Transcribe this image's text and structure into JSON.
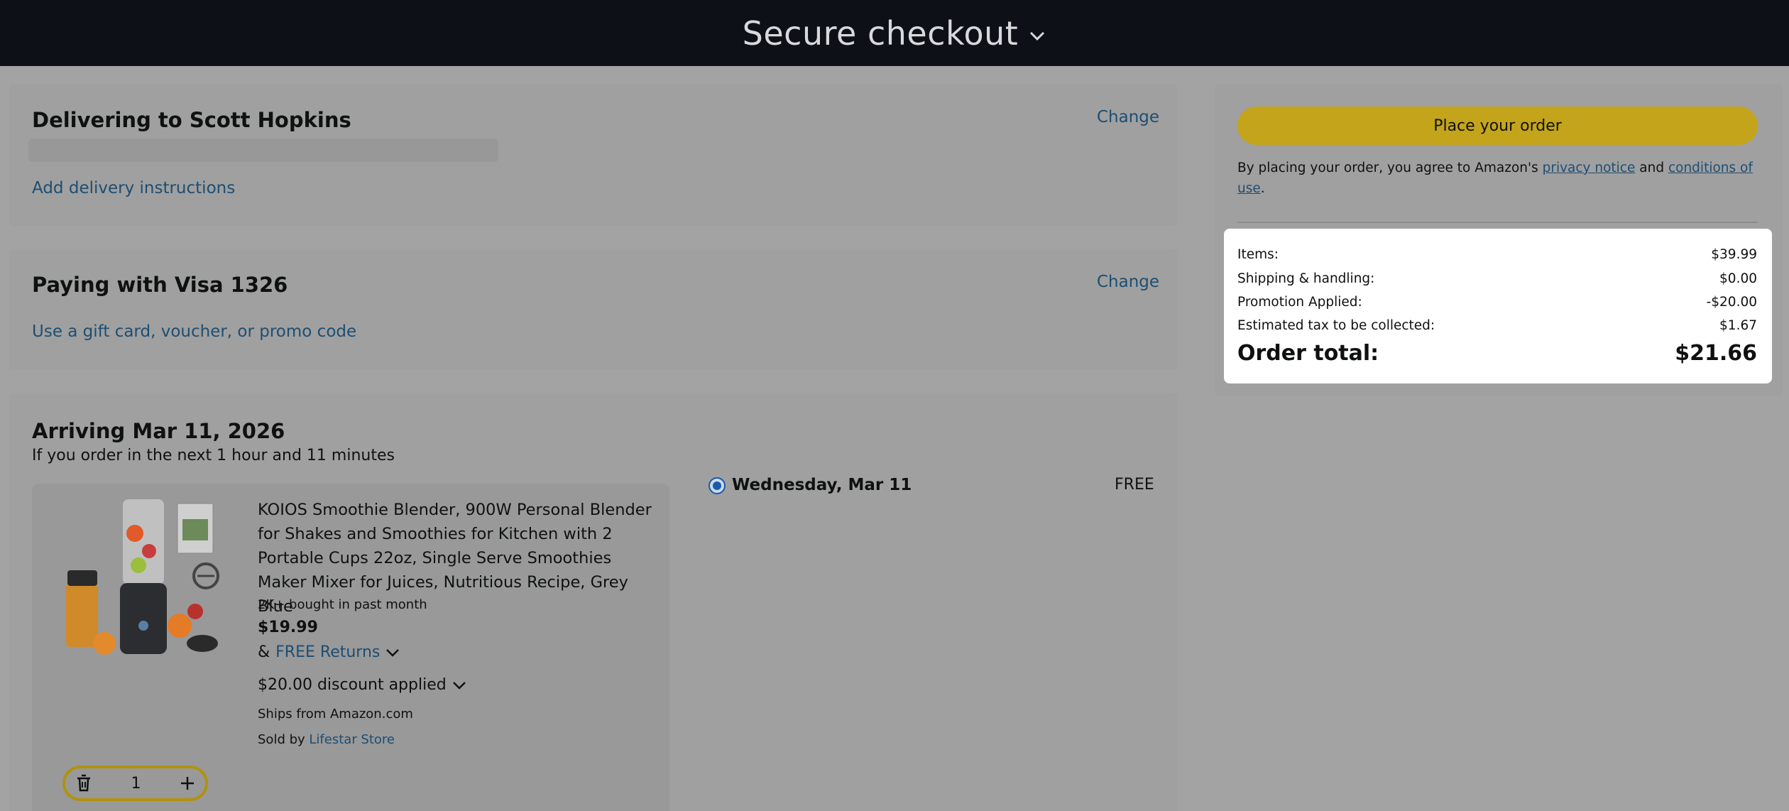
{
  "header": {
    "title": "Secure checkout",
    "chevron_icon": "chevron-down-icon"
  },
  "delivery": {
    "title": "Delivering to Scott Hopkins",
    "change_label": "Change",
    "instructions_link": "Add delivery instructions"
  },
  "payment": {
    "title": "Paying with Visa 1326",
    "change_label": "Change",
    "gift_link": "Use a gift card, voucher, or promo code"
  },
  "arrival": {
    "title": "Arriving Mar 11, 2026",
    "subtitle": "If you order in the next 1 hour and 11 minutes",
    "item": {
      "title": "KOIOS Smoothie Blender, 900W Personal Blender for Shakes and Smoothies for Kitchen with 2 Portable Cups 22oz, Single Serve Smoothies Maker Mixer for Juices, Nutritious Recipe, Grey Blue",
      "bought": "2K+ bought in past month",
      "price": "$19.99",
      "returns_prefix": "&",
      "returns_link": "FREE Returns",
      "discount": "$20.00 discount applied",
      "ships_from": "Ships from Amazon.com",
      "sold_by_prefix": "Sold by",
      "sold_by_link": "Lifestar Store",
      "quantity": "1"
    },
    "shipping_option": {
      "date": "Wednesday, Mar 11",
      "cost": "FREE",
      "selected": true
    }
  },
  "summary": {
    "place_order_label": "Place your order",
    "agree_prefix": "By placing your order, you agree to Amazon's",
    "privacy_link": "privacy notice",
    "agree_and": "and",
    "conditions_link": "conditions of use",
    "agree_suffix": ".",
    "rows": [
      {
        "label": "Items:",
        "value": "$39.99"
      },
      {
        "label": "Shipping & handling:",
        "value": "$0.00"
      },
      {
        "label": "Promotion Applied:",
        "value": "-$20.00"
      },
      {
        "label": "Estimated tax to be collected:",
        "value": "$1.67"
      }
    ],
    "total_label": "Order total:",
    "total_value": "$21.66"
  },
  "colors": {
    "header_bg": "#0d1117",
    "overlay_bg": "#a3a3a3",
    "button": "#c4a41a",
    "link": "#1d4e72"
  }
}
